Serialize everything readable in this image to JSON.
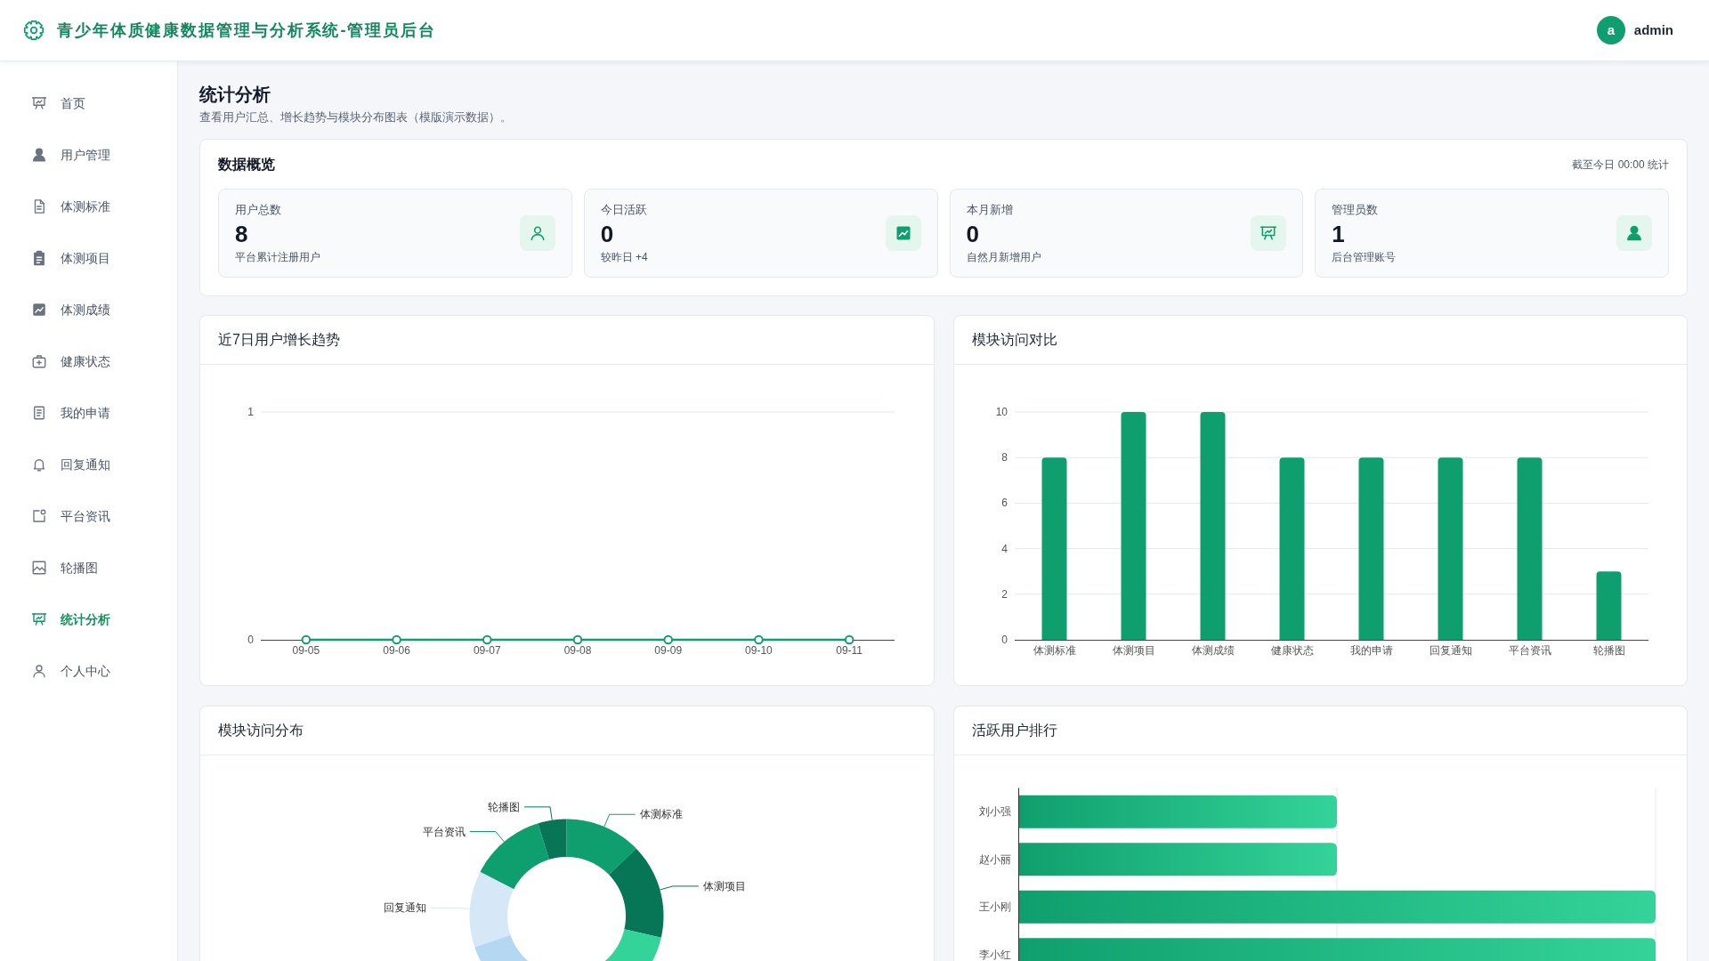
{
  "header": {
    "title": "青少年体质健康数据管理与分析系统-管理员后台",
    "avatar_letter": "a",
    "username": "admin"
  },
  "sidebar": {
    "items": [
      {
        "label": "首页",
        "selected": false
      },
      {
        "label": "用户管理",
        "selected": false
      },
      {
        "label": "体测标准",
        "selected": false
      },
      {
        "label": "体测项目",
        "selected": false
      },
      {
        "label": "体测成绩",
        "selected": false
      },
      {
        "label": "健康状态",
        "selected": false
      },
      {
        "label": "我的申请",
        "selected": false
      },
      {
        "label": "回复通知",
        "selected": false
      },
      {
        "label": "平台资讯",
        "selected": false
      },
      {
        "label": "轮播图",
        "selected": false
      },
      {
        "label": "统计分析",
        "selected": true
      },
      {
        "label": "个人中心",
        "selected": false
      }
    ]
  },
  "page": {
    "title": "统计分析",
    "subtitle": "查看用户汇总、增长趋势与模块分布图表（模版演示数据）。"
  },
  "overview": {
    "title": "数据概览",
    "note": "截至今日 00:00 统计",
    "stats": [
      {
        "label": "用户总数",
        "value": "8",
        "caption": "平台累计注册用户"
      },
      {
        "label": "今日活跃",
        "value": "0",
        "caption": "较昨日 +4"
      },
      {
        "label": "本月新增",
        "value": "0",
        "caption": "自然月新增用户"
      },
      {
        "label": "管理员数",
        "value": "1",
        "caption": "后台管理账号"
      }
    ]
  },
  "growth_chart": {
    "title": "近7日用户增长趋势",
    "chart_data": {
      "type": "line",
      "categories": [
        "09-05",
        "09-06",
        "09-07",
        "09-08",
        "09-09",
        "09-10",
        "09-11"
      ],
      "series": [
        {
          "color": "#0f9f6e",
          "marker": "circle",
          "values": [
            0,
            0,
            0,
            0,
            0,
            0,
            0
          ]
        }
      ],
      "ylim": [
        0,
        1
      ],
      "yticks": [
        0,
        1
      ],
      "grid": true
    }
  },
  "module_chart": {
    "title": "模块访问对比",
    "chart_data": {
      "type": "bar",
      "categories": [
        "体测标准",
        "体测项目",
        "体测成绩",
        "健康状态",
        "我的申请",
        "回复通知",
        "平台资讯",
        "轮播图"
      ],
      "series": [
        {
          "color": "#0f9f6e",
          "values": [
            8,
            10,
            10,
            8,
            8,
            8,
            8,
            3
          ]
        }
      ],
      "ylim": [
        0,
        10
      ],
      "yticks": [
        0,
        2,
        4,
        6,
        8,
        10
      ],
      "grid": true
    }
  },
  "distribution": {
    "title": "模块访问分布",
    "slices": [
      {
        "label": "体测标准",
        "color": "#0f9f6e"
      },
      {
        "label": "体测项目",
        "color": "#067656"
      },
      {
        "color": "#34d399"
      },
      {
        "color": "#b4d8f2"
      },
      {
        "label": "回复通知",
        "color": "#d6e8f7"
      },
      {
        "label": "平台资讯",
        "color": "#0f9f6e"
      },
      {
        "label": "轮播图",
        "color": "#067656"
      }
    ]
  },
  "ranking": {
    "title": "活跃用户排行",
    "users": [
      "刘小强",
      "赵小丽",
      "王小刚",
      "李小红"
    ]
  }
}
